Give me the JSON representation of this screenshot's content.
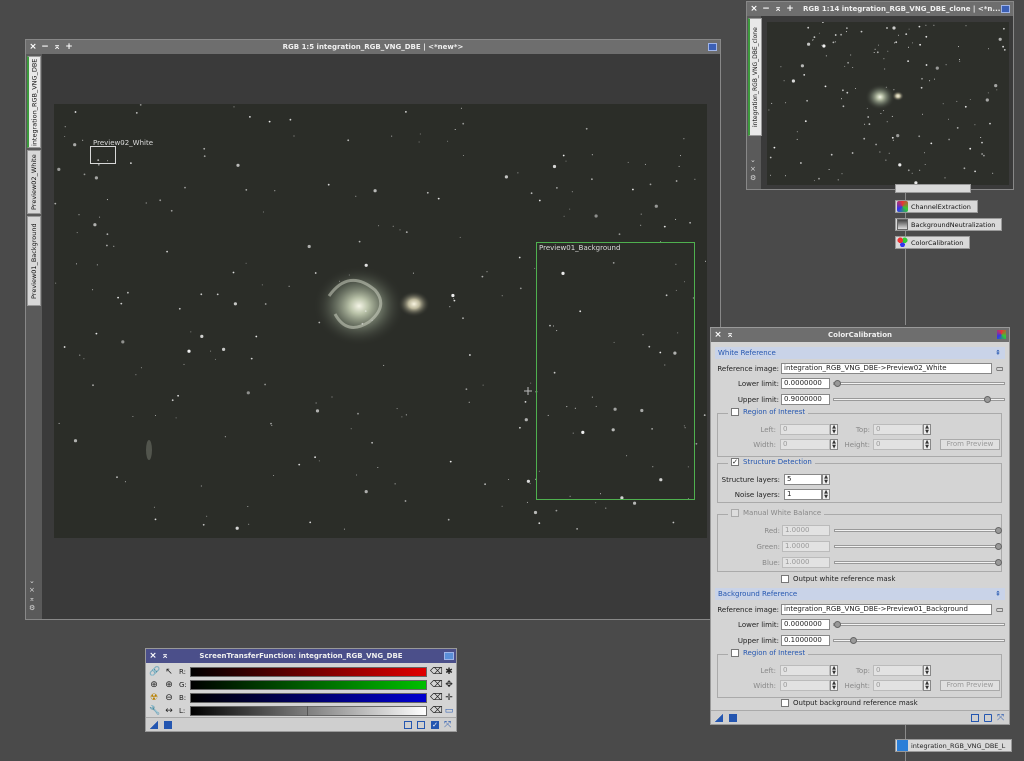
{
  "main_window": {
    "title": "RGB 1:5 integration_RGB_VNG_DBE | <*new*>",
    "tabs": [
      "integration_RGB_VNG_DBE",
      "Preview02_White",
      "Preview01_Background"
    ],
    "previews": {
      "white": "Preview02_White",
      "background": "Preview01_Background"
    }
  },
  "clone_window": {
    "title": "RGB 1:14 integration_RGB_VNG_DBE_clone | <*n...",
    "tab": "integration_RGB_VNG_DBE_clone"
  },
  "process_icons": [
    "ChannelExtraction",
    "BackgroundNeutralization",
    "ColorCalibration"
  ],
  "bottom_icon": "integration_RGB_VNG_DBE_L",
  "color_calibration": {
    "title": "ColorCalibration",
    "white_reference": {
      "section": "White Reference",
      "reference_image_label": "Reference image:",
      "reference_image": "integration_RGB_VNG_DBE->Preview02_White",
      "lower_limit_label": "Lower limit:",
      "lower_limit": "0.0000000",
      "upper_limit_label": "Upper limit:",
      "upper_limit": "0.9000000",
      "roi": {
        "title": "Region of Interest",
        "left_label": "Left:",
        "left": "0",
        "top_label": "Top:",
        "top": "0",
        "width_label": "Width:",
        "width": "0",
        "height_label": "Height:",
        "height": "0",
        "from_preview": "From Preview"
      },
      "structure_detection": {
        "title": "Structure Detection",
        "structure_layers_label": "Structure layers:",
        "structure_layers": "5",
        "noise_layers_label": "Noise layers:",
        "noise_layers": "1"
      },
      "manual_wb": {
        "title": "Manual White Balance",
        "red_label": "Red:",
        "red": "1.0000",
        "green_label": "Green:",
        "green": "1.0000",
        "blue_label": "Blue:",
        "blue": "1.0000"
      },
      "output_mask": "Output white reference mask"
    },
    "background_reference": {
      "section": "Background Reference",
      "reference_image_label": "Reference image:",
      "reference_image": "integration_RGB_VNG_DBE->Preview01_Background",
      "lower_limit_label": "Lower limit:",
      "lower_limit": "0.0000000",
      "upper_limit_label": "Upper limit:",
      "upper_limit": "0.1000000",
      "roi": {
        "title": "Region of Interest",
        "left_label": "Left:",
        "left": "0",
        "top_label": "Top:",
        "top": "0",
        "width_label": "Width:",
        "width": "0",
        "height_label": "Height:",
        "height": "0",
        "from_preview": "From Preview"
      },
      "output_mask": "Output background reference mask"
    }
  },
  "stf": {
    "title": "ScreenTransferFunction: integration_RGB_VNG_DBE",
    "channels": [
      "R:",
      "G:",
      "B:",
      "L:"
    ],
    "colors": {
      "r": "#e00000",
      "g": "#00c000",
      "b": "#0000d0"
    }
  }
}
